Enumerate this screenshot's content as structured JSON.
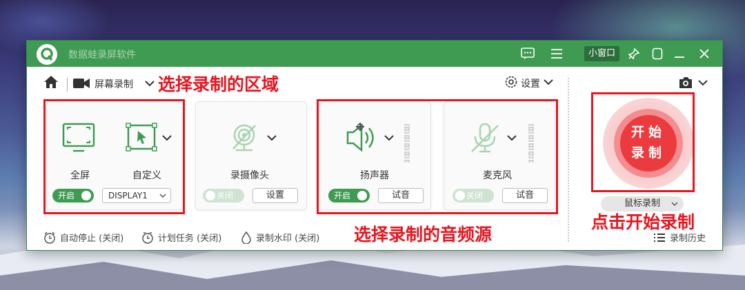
{
  "app": {
    "title": "数据蛙录屏软件",
    "mini_window": "小窗口",
    "accent_color": "#3f9b52",
    "title_icons": [
      "chat-icon",
      "menu-icon",
      "pin-icon",
      "skin-icon",
      "minimize-icon",
      "close-icon"
    ]
  },
  "toolbar": {
    "mode_label": "屏幕录制",
    "settings_label": "设置"
  },
  "region": {
    "fullscreen_label": "全屏",
    "custom_label": "自定义",
    "toggle_label": "开启",
    "display_value": "DISPLAY1"
  },
  "webcam": {
    "label": "录摄像头",
    "toggle_label": "关闭",
    "settings_btn": "设置"
  },
  "speaker": {
    "label": "扬声器",
    "toggle_label": "开启",
    "test_btn": "试音"
  },
  "mic": {
    "label": "麦克风",
    "toggle_label": "关闭",
    "test_btn": "试音"
  },
  "record": {
    "start_line1": "开始",
    "start_line2": "录制",
    "mouse_record": "鼠标录制",
    "start_color": "#ec3b3f"
  },
  "bottom": {
    "auto_stop": "自动停止 (关闭)",
    "schedule": "计划任务 (关闭)",
    "watermark": "录制水印 (关闭)",
    "history": "录制历史"
  },
  "annotations": {
    "region": "选择录制的区域",
    "audio": "选择录制的音频源",
    "start": "点击开始录制",
    "color": "#e8141e"
  }
}
